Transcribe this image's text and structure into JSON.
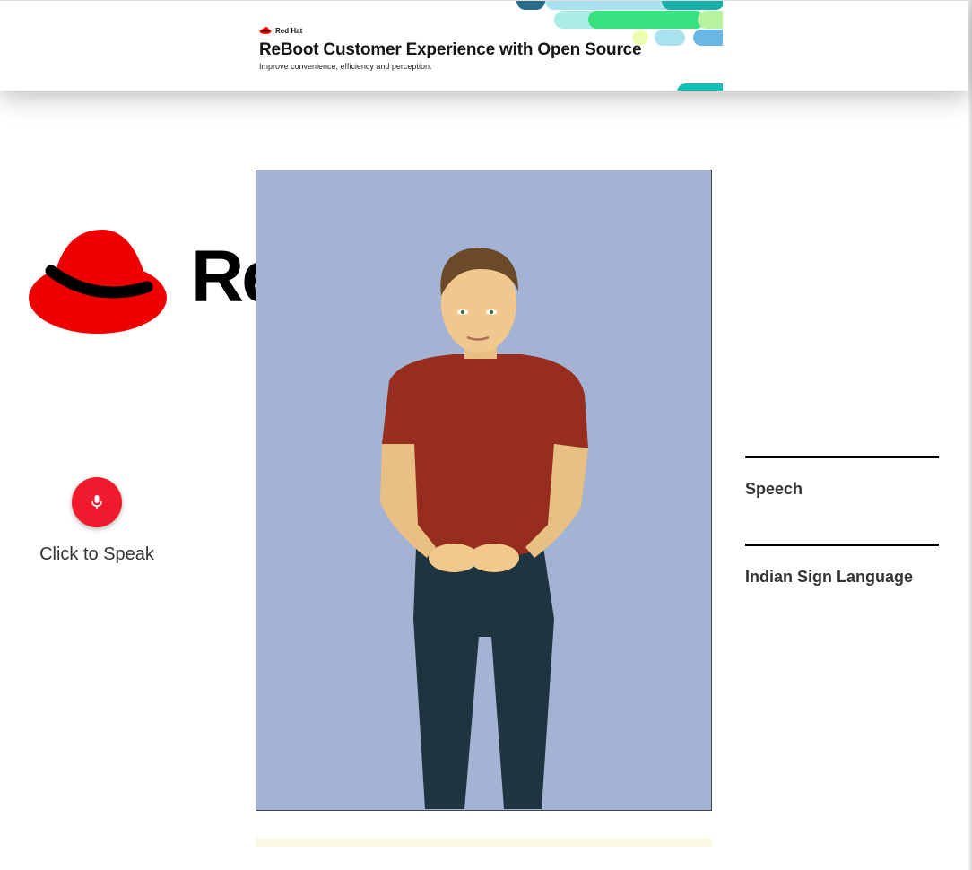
{
  "ad": {
    "brand": "Red Hat",
    "title": "ReBoot Customer Experience with Open Source",
    "subtitle": "Improve convenience, efficiency and perception."
  },
  "logo": {
    "text": "Re"
  },
  "speak": {
    "label": "Click to Speak",
    "icon": "microphone-icon"
  },
  "sections": {
    "speech": "Speech",
    "sign_language": "Indian Sign Language"
  },
  "colors": {
    "brand_red": "#ee0000",
    "mic_red": "#f0192e",
    "avatar_bg": "#a4b3d4"
  }
}
